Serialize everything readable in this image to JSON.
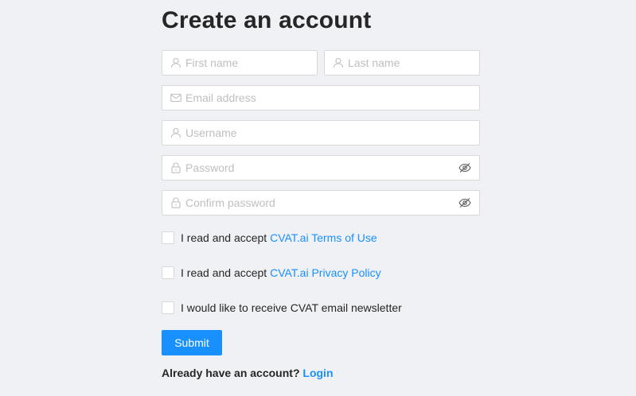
{
  "page": {
    "title": "Create an account"
  },
  "fields": {
    "first_name": {
      "placeholder": "First name",
      "icon": "user-icon"
    },
    "last_name": {
      "placeholder": "Last name",
      "icon": "user-icon"
    },
    "email": {
      "placeholder": "Email address",
      "icon": "mail-icon"
    },
    "username": {
      "placeholder": "Username",
      "icon": "user-icon"
    },
    "password": {
      "placeholder": "Password",
      "icon": "lock-icon",
      "suffix_icon": "eye-invisible-icon"
    },
    "confirm_password": {
      "placeholder": "Confirm password",
      "icon": "lock-icon",
      "suffix_icon": "eye-invisible-icon"
    }
  },
  "checkboxes": {
    "terms": {
      "text": "I read and accept ",
      "link": "CVAT.ai Terms of Use",
      "checked": false
    },
    "privacy": {
      "text": "I read and accept ",
      "link": "CVAT.ai Privacy Policy",
      "checked": false
    },
    "newsletter": {
      "text": "I would like to receive CVAT email newsletter",
      "checked": false
    }
  },
  "submit": {
    "label": "Submit"
  },
  "login": {
    "text": "Already have an account? ",
    "link": "Login"
  },
  "colors": {
    "accent": "#1890ff",
    "background": "#f0f1f5",
    "placeholder": "#bfbfbf",
    "border": "#d9d9d9"
  }
}
